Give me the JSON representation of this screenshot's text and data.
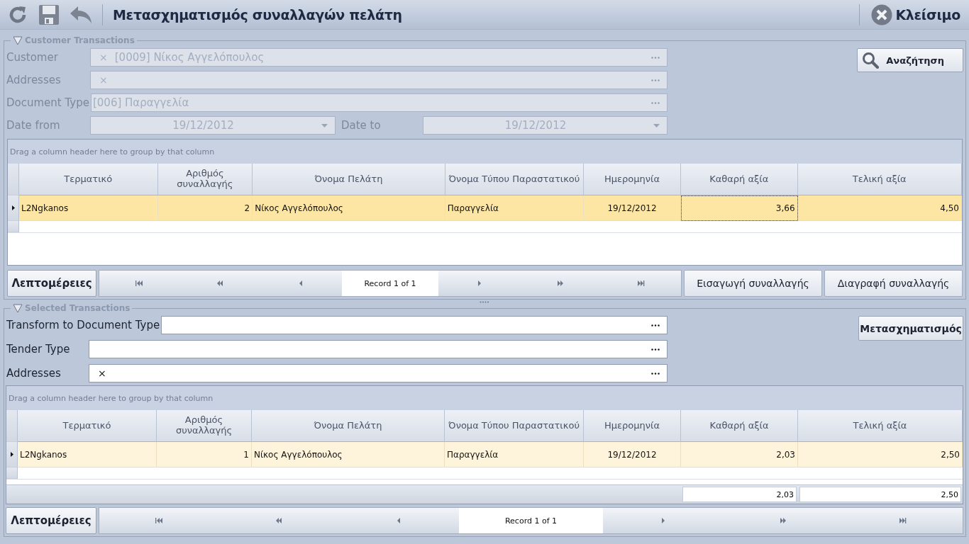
{
  "toolbar": {
    "title": "Μετασχηματισμός συναλλαγών πελάτη",
    "close_label": "Κλείσιμο"
  },
  "customer_transactions": {
    "title": "Customer Transactions",
    "expanded": true,
    "fields": [
      {
        "label": "Customer",
        "clear": "×",
        "value": "[0009] Νίκος Αγγελόπουλος",
        "disabled": true
      },
      {
        "label": "Addresses",
        "clear": "×",
        "disabled": true
      },
      {
        "label": "Document Type",
        "value": "[006] Παραγγελία",
        "disabled": true
      }
    ],
    "date_from": {
      "label": "Date from",
      "value": "19/12/2012",
      "disabled": true
    },
    "date_to": {
      "label": "Date to",
      "value": "19/12/2012",
      "disabled": true
    },
    "search_button": "Αναζήτηση",
    "grid": {
      "group_hint": "Drag a column header here to group by that column",
      "columns": [
        "Τερματικό",
        "Αριθμός συναλλαγής",
        "Όνομα Πελάτη",
        "Όνομα Τύπου Παραστατικού",
        "Ημερομηνία",
        "Καθαρή αξία",
        "Τελική αξία"
      ],
      "rows": [
        {
          "selected": true,
          "cells": [
            {
              "text": "L2Ngkanos",
              "focused": false
            },
            {
              "text": "2",
              "focused": false
            },
            {
              "text": "Νίκος Αγγελόπουλος",
              "focused": false
            },
            {
              "text": "Παραγγελία",
              "focused": false
            },
            {
              "text": "19/12/2012",
              "focused": false
            },
            {
              "text": "3,66",
              "focused": true
            },
            {
              "text": "4,50",
              "focused": false
            }
          ]
        }
      ]
    },
    "details_button": "Λεπτομέρειες",
    "navigator": {
      "record_text": "Record 1 of 1"
    },
    "buttons": [
      "Εισαγωγή συναλλαγής",
      "Διαγραφή συναλλαγής"
    ]
  },
  "selected_transactions": {
    "title": "Selected Transactions",
    "expanded": true,
    "fields": [
      {
        "label": "Transform to Document Type",
        "disabled": false
      },
      {
        "label": "Tender Type",
        "disabled": false
      },
      {
        "label": "Addresses",
        "clear": "×",
        "disabled": false
      }
    ],
    "transform_button": "Μετασχηματισμός",
    "grid": {
      "group_hint": "Drag a column header here to group by that column",
      "columns": [
        "Τερματικό",
        "Αριθμός συναλλαγής",
        "Όνομα Πελάτη",
        "Όνομα Τύπου Παραστατικού",
        "Ημερομηνία",
        "Καθαρή αξία",
        "Τελική αξία"
      ],
      "rows": [
        {
          "selected": false,
          "cells": [
            {
              "text": "L2Ngkanos",
              "focused": false
            },
            {
              "text": "1",
              "focused": false
            },
            {
              "text": "Νίκος Αγγελόπουλος",
              "focused": false
            },
            {
              "text": "Παραγγελία",
              "focused": false
            },
            {
              "text": "19/12/2012",
              "focused": false
            },
            {
              "text": "2,03",
              "focused": false
            },
            {
              "text": "2,50",
              "focused": false
            }
          ]
        }
      ],
      "totals": [
        "2,03",
        "2,50"
      ]
    },
    "details_button": "Λεπτομέρειες",
    "navigator": {
      "record_text": "Record 1 of 1"
    }
  }
}
